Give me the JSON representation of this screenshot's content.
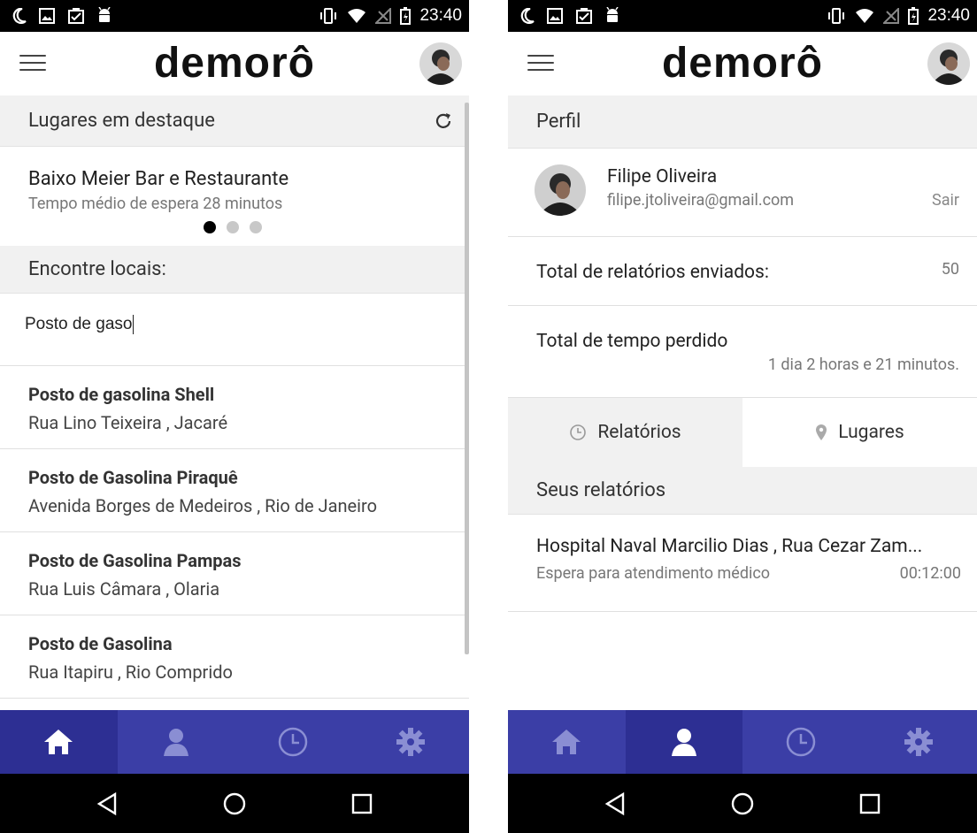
{
  "status_bar": {
    "time": "23:40"
  },
  "app": {
    "logo": "demorô"
  },
  "left": {
    "featured_header": "Lugares em destaque",
    "featured": {
      "title": "Baixo Meier Bar e Restaurante",
      "subtitle": "Tempo médio de espera 28 minutos",
      "page_index": 1,
      "page_count": 3
    },
    "find_header": "Encontre locais:",
    "search_value": "Posto de gaso",
    "results": [
      {
        "name": "Posto de gasolina Shell",
        "address": "Rua Lino Teixeira , Jacaré"
      },
      {
        "name": "Posto de Gasolina Piraquê",
        "address": "Avenida Borges de Medeiros , Rio de Janeiro"
      },
      {
        "name": "Posto de Gasolina Pampas",
        "address": "Rua Luis Câmara , Olaria"
      },
      {
        "name": "Posto de Gasolina",
        "address": "Rua Itapiru , Rio Comprido"
      }
    ],
    "active_nav": "home"
  },
  "right": {
    "profile_header": "Perfil",
    "user": {
      "name": "Filipe Oliveira",
      "email": "filipe.jtoliveira@gmail.com",
      "logout": "Sair"
    },
    "reports_sent_label": "Total de relatórios enviados:",
    "reports_sent_value": "50",
    "time_lost_label": "Total de tempo perdido",
    "time_lost_value": "1 dia 2 horas e 21 minutos.",
    "tabs": {
      "reports": "Relatórios",
      "places": "Lugares"
    },
    "my_reports_header": "Seus relatórios",
    "reports": [
      {
        "title": "Hospital Naval Marcilio Dias , Rua Cezar Zam...",
        "description": "Espera para atendimento médico",
        "duration": "00:12:00"
      }
    ],
    "active_nav": "profile"
  },
  "colors": {
    "nav_bg": "#3b3ea6",
    "nav_active": "#2d2f93",
    "section_bg": "#f1f1f1"
  },
  "icons": {
    "status": [
      "moon-icon",
      "image-icon",
      "clipboard-icon",
      "android-icon",
      "vibrate-icon",
      "wifi-icon",
      "no-signal-icon",
      "battery-icon"
    ],
    "nav": [
      "home-icon",
      "person-icon",
      "clock-icon",
      "gear-icon"
    ],
    "system": [
      "back-icon",
      "home-circle-icon",
      "recents-icon"
    ]
  }
}
